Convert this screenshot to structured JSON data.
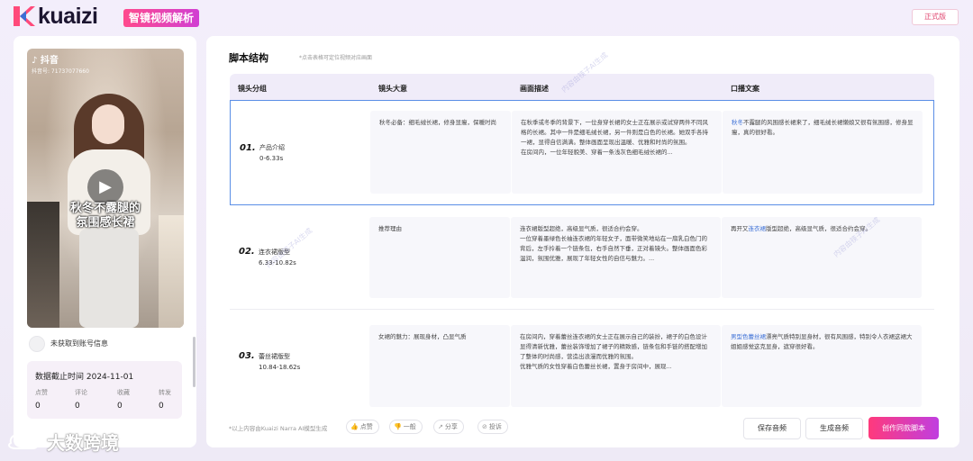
{
  "header": {
    "logo_text": "kuaizi",
    "app_name": "智镜视频解析",
    "version_label": "正式版"
  },
  "video": {
    "platform": "抖音",
    "account_id": "抖音号: 71737077660",
    "overlay_text_line1": "秋冬不露腿的",
    "overlay_text_line2": "氛围感长裙"
  },
  "account": {
    "status_text": "未获取到账号信息"
  },
  "stats": {
    "date_text": "数据截止时间 2024-11-01",
    "items": [
      {
        "label": "点赞",
        "value": "0"
      },
      {
        "label": "评论",
        "value": "0"
      },
      {
        "label": "收藏",
        "value": "0"
      },
      {
        "label": "转发",
        "value": "0"
      }
    ]
  },
  "script": {
    "title": "脚本结构",
    "hint": "*点击表格可定位视频对应画面",
    "columns": [
      "镜头分组",
      "镜头大意",
      "画面描述",
      "口播文案"
    ],
    "rows": [
      {
        "num": "01.",
        "name": "产品介绍",
        "time": "0-6.33s",
        "summary": "秋冬必备：细毛绒长裙，修身显瘦，保暖时尚",
        "description": "在秋季或冬季的背景下，一位身穿长裙的女士正在展示或试穿两件不同风格的长裙。其中一件是细毛绒长裙，另一件则是白色的长裙。她双手各持一裙，显得自信满满。整体画面呈现出温暖、优雅和时尚的氛围。\n在房间内，一位年轻貌美、穿着一条浅灰色细毛绒长裙的...",
        "voice_highlight": "秋冬",
        "voice_rest": "不露腿的风围感长裙来了，细毛绒长裙懒娘又很有氛围感，修身显瘦，真的很好看。"
      },
      {
        "num": "02.",
        "name": "连衣裙版型",
        "time": "6.33-10.82s",
        "summary": "推荐理由",
        "description": "连衣裙版型超绝，高级显气质，很适合约会穿。\n一位穿着墨绿色长袖连衣裙的年轻女子，面带微笑地站在一扇乳白色门的背后，左手拎着一个链条包，右手自然下垂，正对着镜头。整体画面色彩温润，氛围优雅，展现了年轻女性的自信与魅力。...",
        "voice_prefix": "再开又",
        "voice_highlight": "连衣裙",
        "voice_rest": "版型超绝，高级显气质，很适合约会穿。"
      },
      {
        "num": "03.",
        "name": "蕾丝裙版型",
        "time": "10.84-18.62s",
        "summary": "女裙的魅力：展现身材，凸显气质",
        "description": "在房间内，穿着蕾丝连衣裙的女士正在展示自己的装扮，裙子的白色设计显得清新优雅，蕾丝装饰增加了裙子的精致感，链条包和手链的搭配增加了整体的时尚感，营造出浪漫而优雅的氛围。\n优雅气质的女性穿着白色蕾丝长裙，置身于房间中，展现...",
        "voice_highlight": "男型色蕾丝裙",
        "voice_rest": "漂亮气质特别显身材，很有风围感，特别令人衣裙这裙大姐姐感觉这克显身，遮穿很好看。"
      }
    ],
    "footer_note": "*以上内容由Kuaizi Narra AI模型生成",
    "feedback": [
      {
        "icon": "thumbs-up-icon",
        "label": "点赞"
      },
      {
        "icon": "thumbs-down-icon",
        "label": "一般"
      },
      {
        "icon": "share-icon",
        "label": "分享"
      },
      {
        "icon": "report-icon",
        "label": "投诉"
      }
    ],
    "save_audio": "保存音频",
    "generate_audio": "生成音频",
    "create_script": "创作同款脚本"
  },
  "watermark_text": "内容由筷子AI生成",
  "brand_overlay": "大数跨境",
  "colors": {
    "accent_pink": "#ff3a7c",
    "accent_purple": "#c03ee0",
    "highlight_blue": "#3b6fd6",
    "active_border": "#5a8ee6"
  }
}
